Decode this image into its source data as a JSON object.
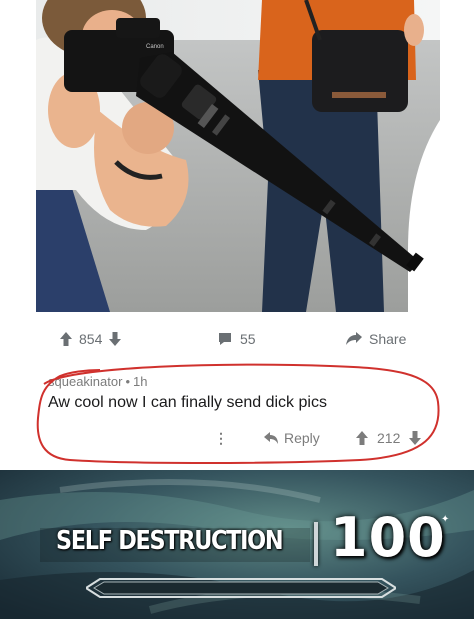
{
  "post": {
    "upvotes": "854",
    "comments": "55",
    "share_label": "Share"
  },
  "comment": {
    "username": "squeakinator",
    "separator": "•",
    "age": "1h",
    "text": "Aw cool now I can finally send dick pics",
    "more": "⋮",
    "reply_label": "Reply",
    "votes": "212"
  },
  "skill": {
    "name": "SELF DESTRUCTION",
    "level": "100",
    "progress_fraction": 0
  },
  "photo": {
    "camera_brand": "Canon"
  },
  "colors": {
    "meta_gray": "#7c7c7c",
    "annotation_red": "#d0312d",
    "banner_bg": "#233a44"
  }
}
